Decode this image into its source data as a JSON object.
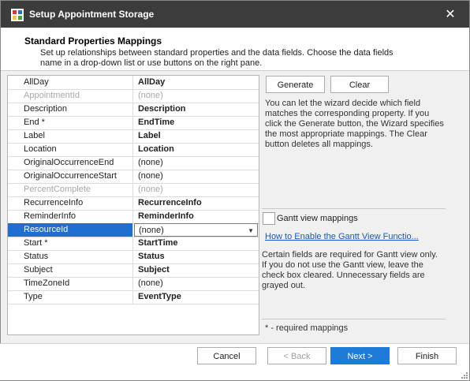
{
  "window": {
    "title": "Setup Appointment Storage",
    "close_glyph": "✕"
  },
  "header": {
    "title": "Standard Properties Mappings",
    "description": "Set up relationships between standard properties and the data fields. Choose the data fields name in a drop-down list or use buttons on the right pane."
  },
  "mappings": [
    {
      "property": "AllDay",
      "value": "AllDay",
      "prop_gray": false,
      "val_bold": true,
      "val_gray": false
    },
    {
      "property": "AppointmentId",
      "value": "(none)",
      "prop_gray": true,
      "val_bold": false,
      "val_gray": true
    },
    {
      "property": "Description",
      "value": "Description",
      "prop_gray": false,
      "val_bold": true,
      "val_gray": false
    },
    {
      "property": "End *",
      "value": "EndTime",
      "prop_gray": false,
      "val_bold": true,
      "val_gray": false
    },
    {
      "property": "Label",
      "value": "Label",
      "prop_gray": false,
      "val_bold": true,
      "val_gray": false
    },
    {
      "property": "Location",
      "value": "Location",
      "prop_gray": false,
      "val_bold": true,
      "val_gray": false
    },
    {
      "property": "OriginalOccurrenceEnd",
      "value": "(none)",
      "prop_gray": false,
      "val_bold": false,
      "val_gray": false
    },
    {
      "property": "OriginalOccurrenceStart",
      "value": "(none)",
      "prop_gray": false,
      "val_bold": false,
      "val_gray": false
    },
    {
      "property": "PercentComplete",
      "value": "(none)",
      "prop_gray": true,
      "val_bold": false,
      "val_gray": true
    },
    {
      "property": "RecurrenceInfo",
      "value": "RecurrenceInfo",
      "prop_gray": false,
      "val_bold": true,
      "val_gray": false
    },
    {
      "property": "ReminderInfo",
      "value": "ReminderInfo",
      "prop_gray": false,
      "val_bold": true,
      "val_gray": false
    },
    {
      "property": "ResourceId",
      "value": "(none)",
      "prop_gray": false,
      "val_bold": false,
      "val_gray": false,
      "selected": true
    },
    {
      "property": "Start *",
      "value": "StartTime",
      "prop_gray": false,
      "val_bold": true,
      "val_gray": false
    },
    {
      "property": "Status",
      "value": "Status",
      "prop_gray": false,
      "val_bold": true,
      "val_gray": false
    },
    {
      "property": "Subject",
      "value": "Subject",
      "prop_gray": false,
      "val_bold": true,
      "val_gray": false
    },
    {
      "property": "TimeZoneId",
      "value": "(none)",
      "prop_gray": false,
      "val_bold": false,
      "val_gray": false
    },
    {
      "property": "Type",
      "value": "EventType",
      "prop_gray": false,
      "val_bold": true,
      "val_gray": false
    }
  ],
  "right_pane": {
    "generate_label": "Generate",
    "clear_label": "Clear",
    "hint": "You can let the wizard decide which field matches the corresponding property. If you click the Generate button, the Wizard specifies the most appropriate mappings. The Clear button deletes all mappings.",
    "gantt_checkbox_label": "Gantt view mappings",
    "gantt_checked": false,
    "gantt_link": "How  to  Enable the Gantt View Functio...",
    "gantt_desc": "Certain fields are required for Gantt view only. If you do not use the Gantt view, leave the check box cleared. Unnecessary fields are grayed out.",
    "required_note": "* - required mappings"
  },
  "footer": {
    "cancel_label": "Cancel",
    "back_label": "< Back",
    "next_label": "Next >",
    "finish_label": "Finish"
  },
  "colors": {
    "titlebar": "#3c3c3c",
    "selection": "#1f6fd0",
    "primary_button": "#1e7bd9",
    "link": "#1a56c7"
  },
  "icons": {
    "app": "app-grid-icon",
    "close": "close-icon",
    "dropdown": "chevron-down-icon"
  }
}
